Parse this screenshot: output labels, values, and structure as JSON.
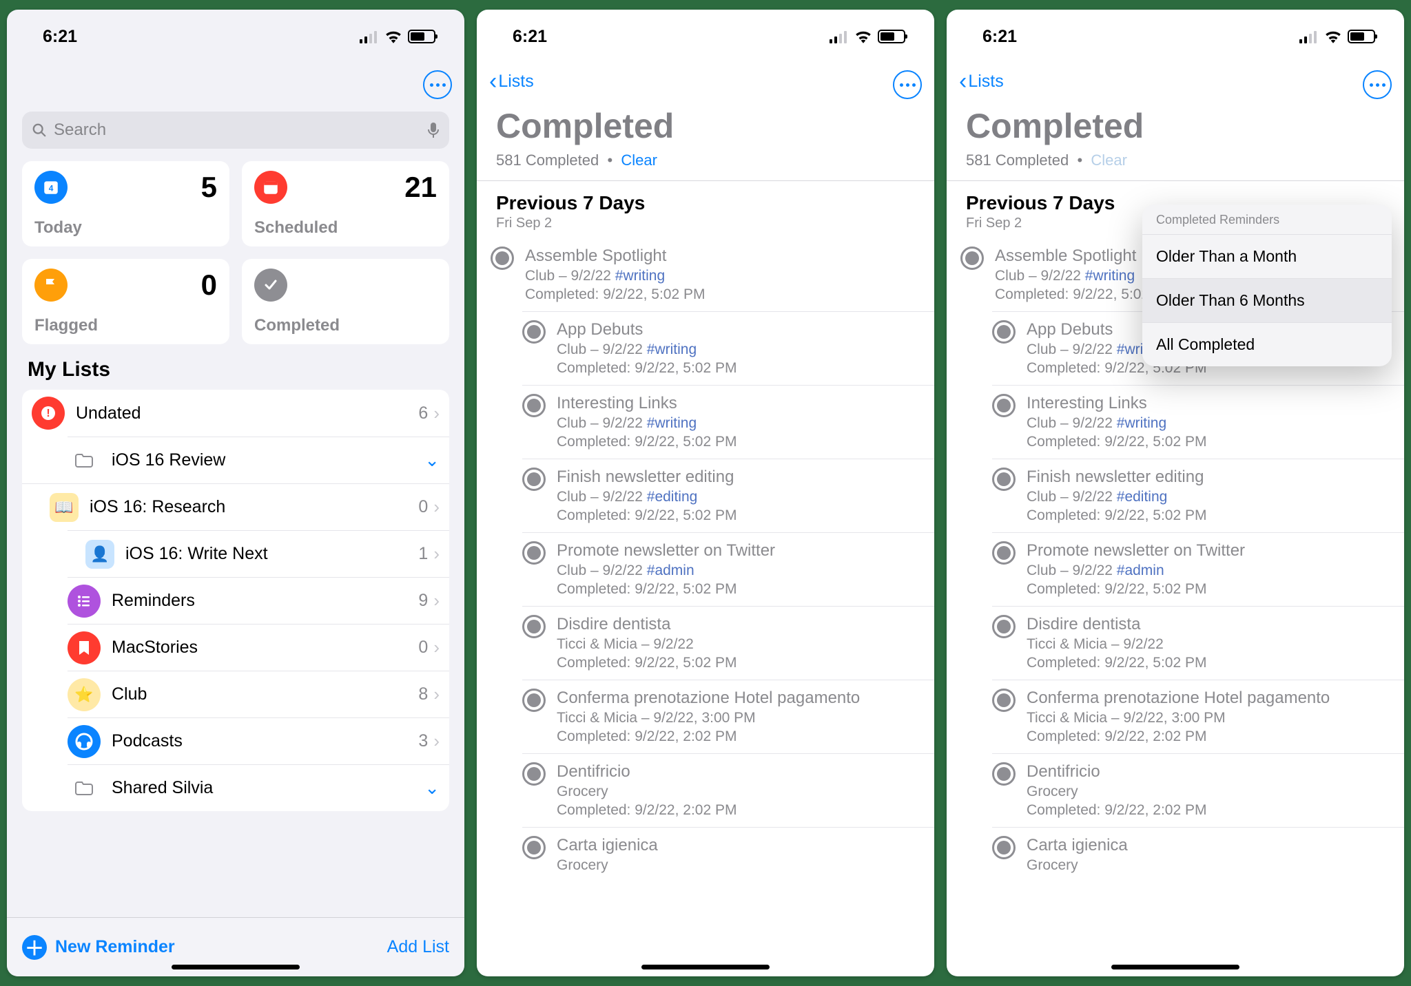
{
  "status": {
    "time": "6:21"
  },
  "screen1": {
    "search_placeholder": "Search",
    "cards": {
      "today": {
        "label": "Today",
        "count": "5"
      },
      "scheduled": {
        "label": "Scheduled",
        "count": "21"
      },
      "flagged": {
        "label": "Flagged",
        "count": "0"
      },
      "completed": {
        "label": "Completed",
        "count": ""
      }
    },
    "my_lists_label": "My Lists",
    "lists": [
      {
        "name": "Undated",
        "count": "6",
        "color": "#ff3b30",
        "icon": "exclaim",
        "chev": "right"
      },
      {
        "name": "iOS 16 Review",
        "count": "",
        "color": "#d1d1d6",
        "icon": "folder",
        "chev": "down",
        "folder": true
      },
      {
        "name": "iOS 16: Research",
        "count": "0",
        "color": "#ffeaa6",
        "icon": "book",
        "chev": "right",
        "sub": true
      },
      {
        "name": "iOS 16: Write Next",
        "count": "1",
        "color": "#c8e4ff",
        "icon": "person",
        "chev": "right",
        "sub": true
      },
      {
        "name": "Reminders",
        "count": "9",
        "color": "#af52de",
        "icon": "list",
        "chev": "right"
      },
      {
        "name": "MacStories",
        "count": "0",
        "color": "#ff3b30",
        "icon": "bookmark",
        "chev": "right"
      },
      {
        "name": "Club",
        "count": "8",
        "color": "#ffe9a6",
        "icon": "star",
        "chev": "right"
      },
      {
        "name": "Podcasts",
        "count": "3",
        "color": "#0a84ff",
        "icon": "head",
        "chev": "right"
      },
      {
        "name": "Shared Silvia",
        "count": "",
        "color": "#d1d1d6",
        "icon": "folder",
        "chev": "down",
        "folder": true
      }
    ],
    "new_reminder": "New Reminder",
    "add_list": "Add List"
  },
  "completed": {
    "back_label": "Lists",
    "title": "Completed",
    "count_text": "581 Completed",
    "bullet": "•",
    "clear": "Clear",
    "section": "Previous 7 Days",
    "date": "Fri Sep 2",
    "items": [
      {
        "title": "Assemble Spotlight",
        "meta1": "Club – 9/2/22 ",
        "tag": "#writing",
        "meta2": "Completed: 9/2/22, 5:02 PM"
      },
      {
        "title": "App Debuts",
        "meta1": "Club – 9/2/22 ",
        "tag": "#writing",
        "meta2": "Completed: 9/2/22, 5:02 PM"
      },
      {
        "title": "Interesting Links",
        "meta1": "Club – 9/2/22 ",
        "tag": "#writing",
        "meta2": "Completed: 9/2/22, 5:02 PM"
      },
      {
        "title": "Finish newsletter editing",
        "meta1": "Club – 9/2/22 ",
        "tag": "#editing",
        "meta2": "Completed: 9/2/22, 5:02 PM"
      },
      {
        "title": "Promote newsletter on Twitter",
        "meta1": "Club – 9/2/22 ",
        "tag": "#admin",
        "meta2": "Completed: 9/2/22, 5:02 PM"
      },
      {
        "title": "Disdire dentista",
        "meta1": "Ticci & Micia – 9/2/22",
        "tag": "",
        "meta2": "Completed: 9/2/22, 5:02 PM"
      },
      {
        "title": "Conferma prenotazione Hotel pagamento",
        "meta1": "Ticci & Micia – 9/2/22, 3:00 PM",
        "tag": "",
        "meta2": "Completed: 9/2/22, 2:02 PM"
      },
      {
        "title": "Dentifricio",
        "meta1": "Grocery",
        "tag": "",
        "meta2": "Completed: 9/2/22, 2:02 PM"
      },
      {
        "title": "Carta igienica",
        "meta1": "Grocery",
        "tag": "",
        "meta2": ""
      }
    ]
  },
  "popup": {
    "header": "Completed Reminders",
    "items": [
      "Older Than a Month",
      "Older Than 6 Months",
      "All Completed"
    ]
  }
}
